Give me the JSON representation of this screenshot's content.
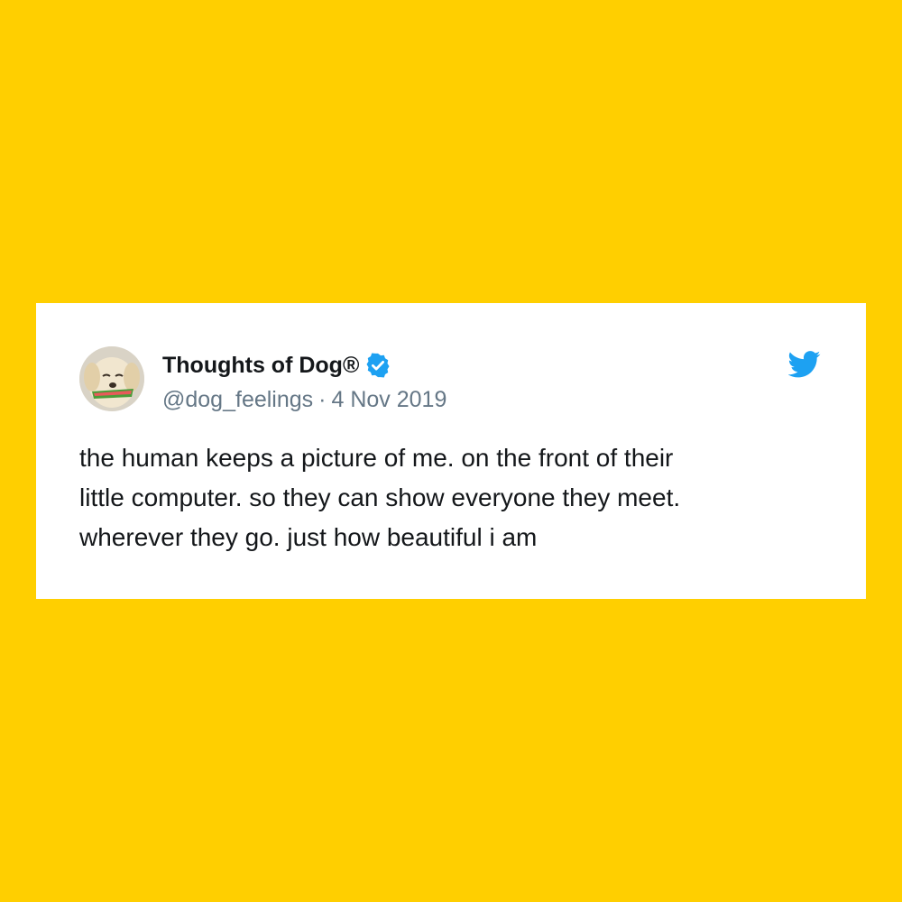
{
  "tweet": {
    "display_name": "Thoughts of Dog®",
    "handle": "@dog_feelings",
    "separator": "·",
    "date": "4 Nov 2019",
    "lines": [
      "the human keeps a picture of me. on the front of their",
      "little computer. so they can show everyone they meet.",
      "wherever they go. just how beautiful i am"
    ],
    "icons": {
      "avatar": "dog-avatar-icon",
      "verified": "verified-badge-icon",
      "logo": "twitter-bird-icon"
    }
  },
  "colors": {
    "background": "#FFCF00",
    "card": "#FFFFFF",
    "text": "#14171A",
    "muted": "#657786",
    "twitter_blue": "#1DA1F2"
  }
}
